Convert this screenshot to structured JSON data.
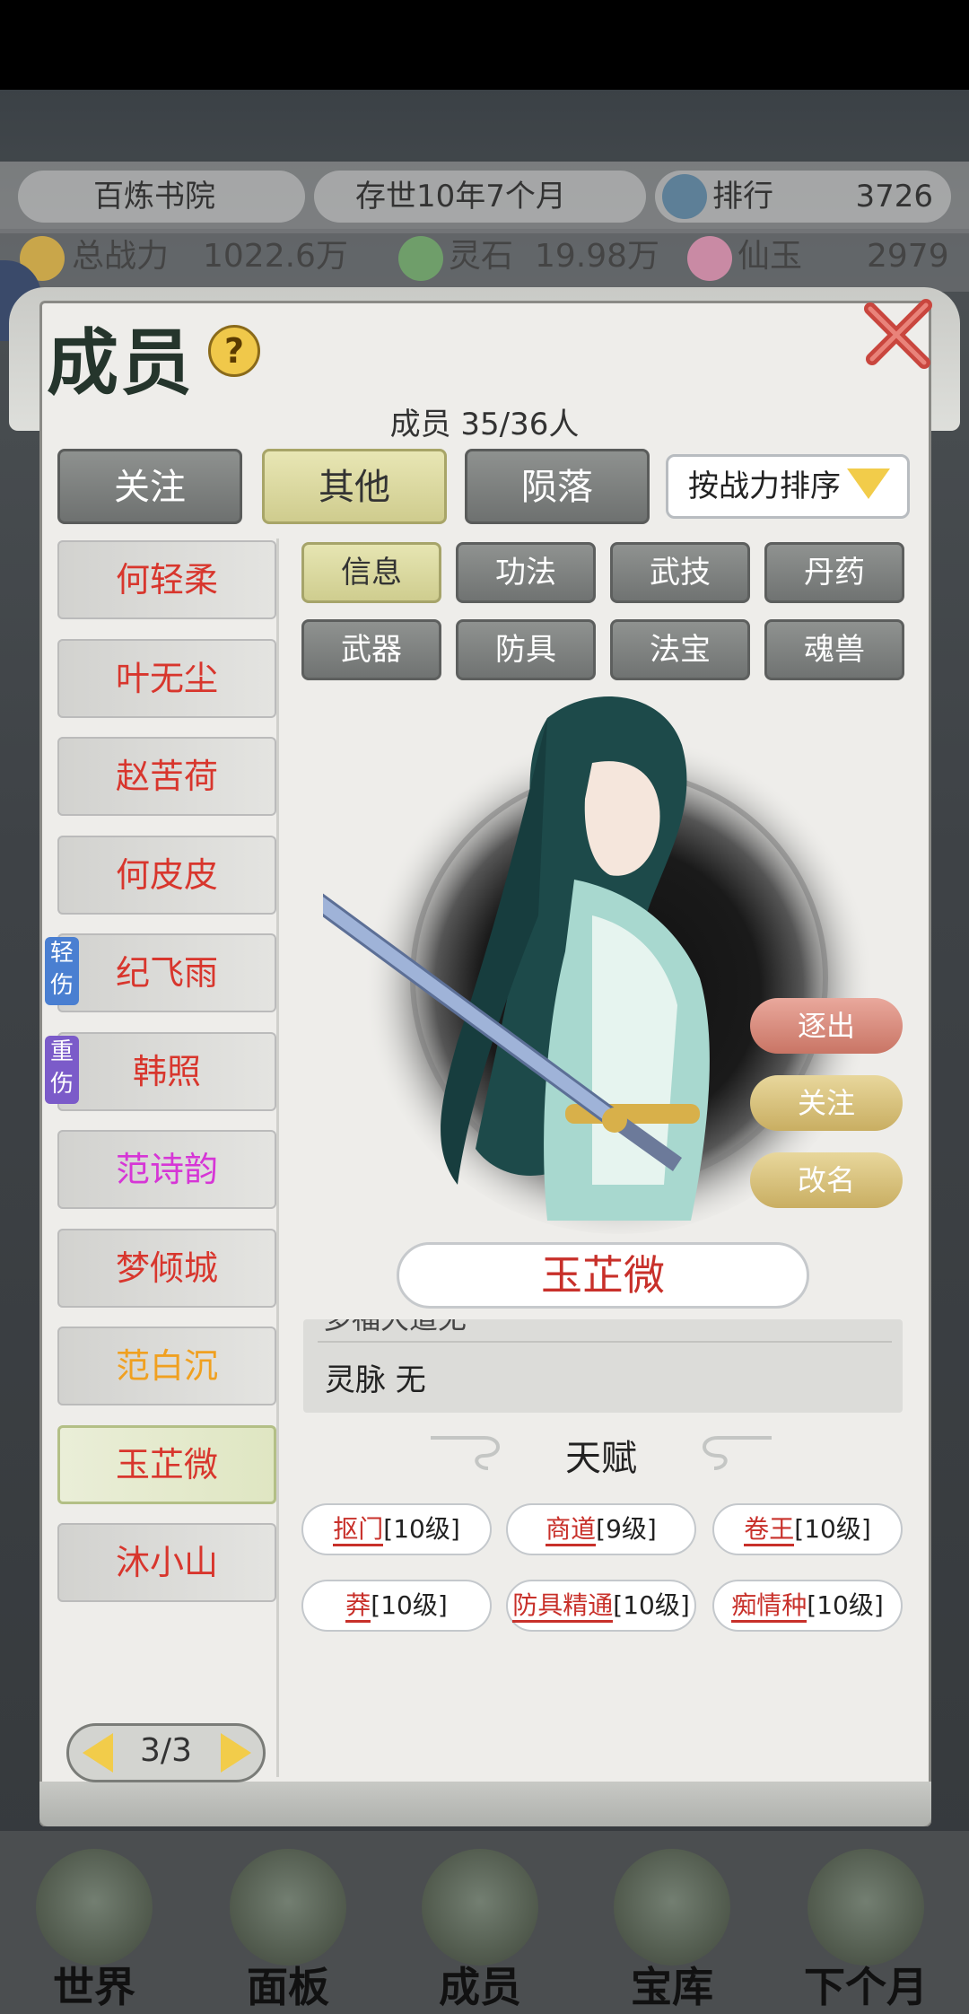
{
  "header": {
    "sect_name": "百炼书院",
    "age": "存世10年7个月",
    "rank_label": "排行",
    "rank_value": "3726",
    "power_label": "总战力",
    "power_value": "1022.6万",
    "spirit_stone_label": "灵石",
    "spirit_stone_value": "19.98万",
    "jade_label": "仙玉",
    "jade_value": "2979"
  },
  "modal": {
    "title": "成员",
    "help": "?",
    "member_count": "成员  35/36人",
    "tabs": [
      {
        "label": "关注"
      },
      {
        "label": "其他",
        "active": true
      },
      {
        "label": "陨落"
      }
    ],
    "sort": {
      "label": "按战力排序"
    }
  },
  "members": [
    {
      "name": "何轻柔",
      "color": "#d8362d"
    },
    {
      "name": "叶无尘",
      "color": "#d8362d"
    },
    {
      "name": "赵苦荷",
      "color": "#d8362d"
    },
    {
      "name": "何皮皮",
      "color": "#d8362d"
    },
    {
      "name": "纪飞雨",
      "color": "#d8362d",
      "badge": "轻伤"
    },
    {
      "name": "韩照",
      "color": "#d8362d",
      "badge": "重伤"
    },
    {
      "name": "范诗韵",
      "color": "#d636d6"
    },
    {
      "name": "梦倾城",
      "color": "#d8362d"
    },
    {
      "name": "范白沉",
      "color": "#f0a020"
    },
    {
      "name": "玉芷微",
      "color": "#d8362d",
      "selected": true
    },
    {
      "name": "沐小山",
      "color": "#d8362d"
    }
  ],
  "badges": {
    "light": "轻伤",
    "heavy": "重伤"
  },
  "info_tabs": [
    {
      "label": "信息",
      "active": true
    },
    {
      "label": "功法"
    },
    {
      "label": "武技"
    },
    {
      "label": "丹药"
    },
    {
      "label": "武器"
    },
    {
      "label": "防具"
    },
    {
      "label": "法宝"
    },
    {
      "label": "魂兽"
    }
  ],
  "actions": {
    "expel": "逐出",
    "follow": "关注",
    "rename": "改名"
  },
  "character": {
    "name": "玉芷微",
    "cut_row": "多福大道无",
    "spirit_vein": "灵脉 无"
  },
  "talents": {
    "header": "天赋",
    "items": [
      {
        "name": "抠门",
        "level": "[10级]"
      },
      {
        "name": "商道",
        "level": "[9级]"
      },
      {
        "name": "卷王",
        "level": "[10级]"
      },
      {
        "name": "莽",
        "level": "[10级]"
      },
      {
        "name": "防具精通",
        "level": "[10级]"
      },
      {
        "name": "痴情种",
        "level": "[10级]"
      }
    ]
  },
  "pager": {
    "text": "3/3"
  },
  "bottom_nav": [
    {
      "label": "世界"
    },
    {
      "label": "面板"
    },
    {
      "label": "成员"
    },
    {
      "label": "宝库"
    },
    {
      "label": "下个月"
    }
  ],
  "colors": {
    "accent_red": "#c8302a",
    "tab_active": "#dedca0",
    "tab_inactive": "#7e8180",
    "gold": "#f2cc4a"
  }
}
